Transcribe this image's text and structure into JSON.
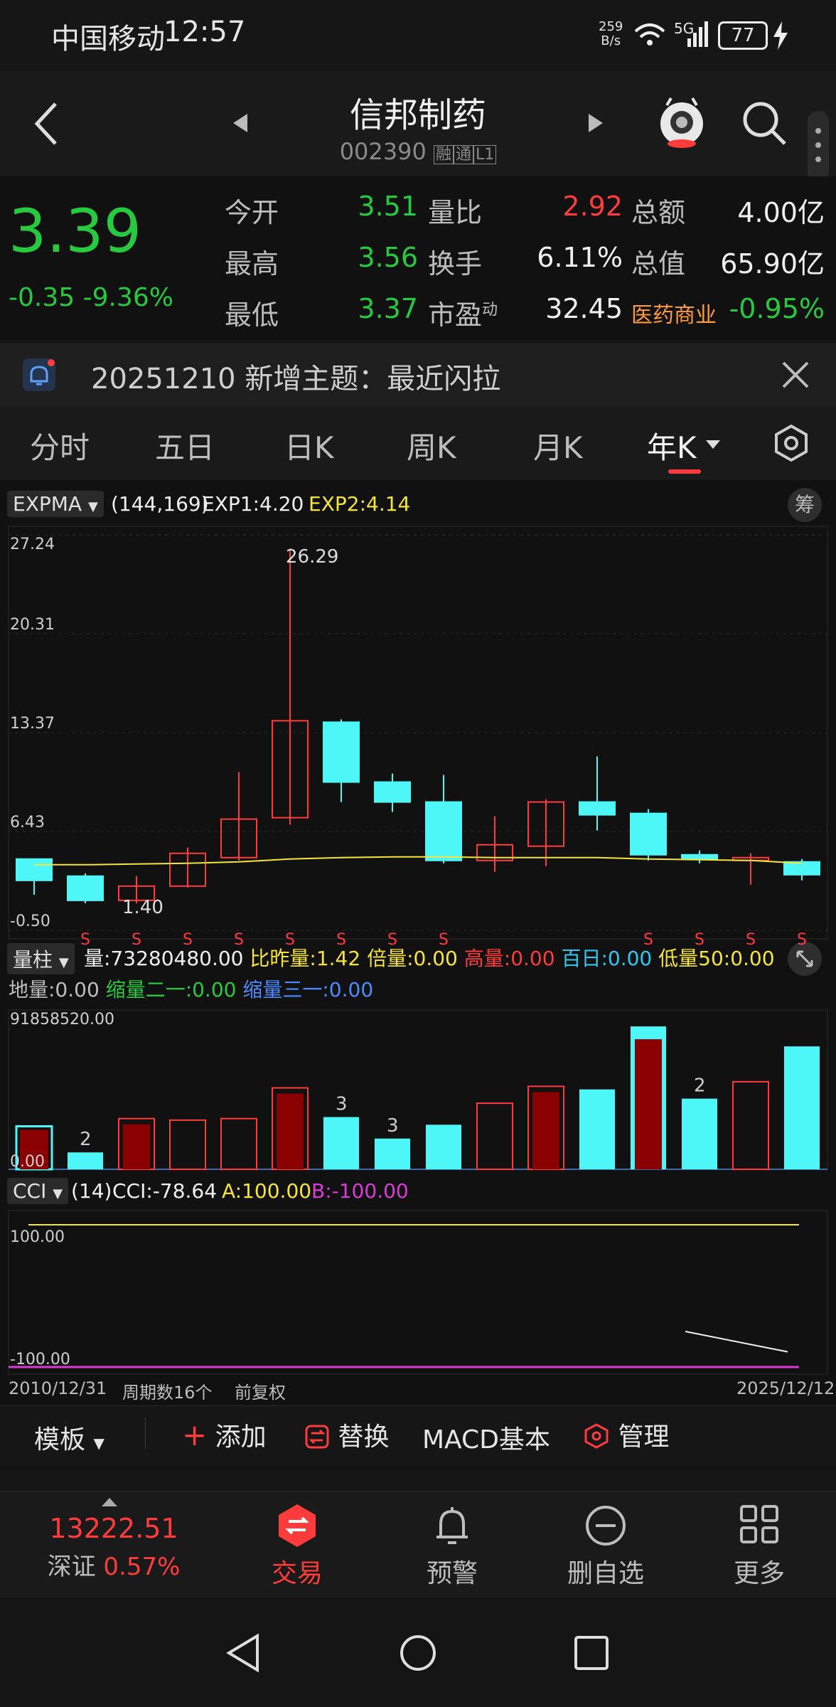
{
  "status_bar": {
    "carrier": "中国移动",
    "time": "12:57",
    "net_speed_value": "259",
    "net_speed_unit": "B/s",
    "network": "5G",
    "battery": "77"
  },
  "header": {
    "stock_name": "信邦制药",
    "stock_code": "002390",
    "tags": [
      "融",
      "通",
      "L1"
    ]
  },
  "quote": {
    "price": "3.39",
    "change": "-0.35",
    "change_pct": "-9.36%",
    "fields": [
      {
        "label": "今开",
        "value": "3.51"
      },
      {
        "label": "量比",
        "value": "2.92"
      },
      {
        "label": "总额",
        "value": "4.00亿"
      },
      {
        "label": "最高",
        "value": "3.56"
      },
      {
        "label": "换手",
        "value": "6.11%"
      },
      {
        "label": "总值",
        "value": "65.90亿"
      },
      {
        "label": "最低",
        "value": "3.37"
      },
      {
        "label": "市盈",
        "label_sup": "动",
        "value": "32.45"
      },
      {
        "label": "医药商业",
        "value": "-0.95%"
      }
    ]
  },
  "notice": {
    "text": "20251210 新增主题：最近闪拉"
  },
  "tabs": [
    "分时",
    "五日",
    "日K",
    "周K",
    "月K",
    "年K"
  ],
  "active_tab": "年K",
  "main_indicator": {
    "name": "EXPMA",
    "params": "(144,169)",
    "exp1": "EXP1:4.20",
    "exp2": "EXP2:4.14",
    "chip_label": "筹",
    "y_ticks": [
      "27.24",
      "20.31",
      "13.37",
      "6.43",
      "-0.50"
    ],
    "high_label": "26.29",
    "low_label": "1.40",
    "s_marker": "S"
  },
  "volume_indicator": {
    "name": "量柱",
    "labels": [
      {
        "text": "量:73280480.00",
        "color": "#f0f0f0"
      },
      {
        "text": "比昨量:1.42",
        "color": "#f5e43a"
      },
      {
        "text": "倍量:0.00",
        "color": "#f5e43a"
      },
      {
        "text": "高量:0.00",
        "color": "#ff3b3b"
      },
      {
        "text": "百日:0.00",
        "color": "#2fc9f0"
      },
      {
        "text": "低量50:0.00",
        "color": "#f5e43a"
      }
    ],
    "labels2": [
      {
        "text": "地量:0.00",
        "color": "#bdbdbd"
      },
      {
        "text": "缩量二一:0.00",
        "color": "#27c93f"
      },
      {
        "text": "缩量三一:0.00",
        "color": "#4b8bff"
      }
    ],
    "y_ticks": [
      "91858520.00",
      "0.00"
    ],
    "bar_marks": [
      "2",
      "3",
      "3",
      "2"
    ]
  },
  "cci_indicator": {
    "name": "CCI",
    "params": "(14)",
    "cci": "CCI:-78.64",
    "a": "A:100.00",
    "b": "B:-100.00",
    "y_ticks": [
      "100.00",
      "-100.00"
    ]
  },
  "axis_footer": {
    "start": "2010/12/31",
    "period": "周期数16个",
    "adjust": "前复权",
    "end": "2025/12/12"
  },
  "chart_data": {
    "type": "candlestick",
    "ylim": [
      -0.5,
      27.24
    ],
    "candles": [
      {
        "o": 4.5,
        "c": 3.0,
        "h": 4.5,
        "l": 2.0,
        "dir": "down",
        "s": false
      },
      {
        "o": 3.3,
        "c": 1.6,
        "h": 3.5,
        "l": 1.4,
        "dir": "down",
        "s": true
      },
      {
        "o": 1.6,
        "c": 2.6,
        "h": 3.3,
        "l": 1.4,
        "dir": "up",
        "s": true
      },
      {
        "o": 2.6,
        "c": 4.9,
        "h": 5.3,
        "l": 2.5,
        "dir": "up",
        "s": true
      },
      {
        "o": 4.6,
        "c": 7.3,
        "h": 10.6,
        "l": 4.4,
        "dir": "up",
        "s": true
      },
      {
        "o": 7.4,
        "c": 14.2,
        "h": 26.29,
        "l": 6.9,
        "dir": "up",
        "s": true
      },
      {
        "o": 14.1,
        "c": 9.9,
        "h": 14.3,
        "l": 8.5,
        "dir": "down",
        "s": true
      },
      {
        "o": 9.9,
        "c": 8.5,
        "h": 10.5,
        "l": 7.8,
        "dir": "down",
        "s": true
      },
      {
        "o": 8.5,
        "c": 4.4,
        "h": 10.4,
        "l": 4.2,
        "dir": "down",
        "s": true
      },
      {
        "o": 4.4,
        "c": 5.5,
        "h": 7.5,
        "l": 3.6,
        "dir": "up",
        "s": false
      },
      {
        "o": 5.4,
        "c": 8.5,
        "h": 8.7,
        "l": 4.0,
        "dir": "up",
        "s": false
      },
      {
        "o": 8.5,
        "c": 7.6,
        "h": 11.7,
        "l": 6.5,
        "dir": "down",
        "s": false
      },
      {
        "o": 7.7,
        "c": 4.8,
        "h": 8.0,
        "l": 4.4,
        "dir": "down",
        "s": true
      },
      {
        "o": 4.8,
        "c": 4.5,
        "h": 5.1,
        "l": 4.2,
        "dir": "down",
        "s": true
      },
      {
        "o": 4.4,
        "c": 4.6,
        "h": 4.9,
        "l": 2.7,
        "dir": "up",
        "s": true
      },
      {
        "o": 4.3,
        "c": 3.4,
        "h": 4.5,
        "l": 3.0,
        "dir": "down",
        "s": true
      }
    ],
    "expma": [
      4.1,
      4.1,
      4.15,
      4.2,
      4.3,
      4.5,
      4.6,
      4.65,
      4.65,
      4.6,
      4.6,
      4.6,
      4.5,
      4.45,
      4.4,
      4.2
    ],
    "volume": [
      {
        "v": 0.28,
        "type": "hollow-red-fill"
      },
      {
        "v": 0.11,
        "type": "cyan"
      },
      {
        "v": 0.33,
        "type": "red-fill"
      },
      {
        "v": 0.32,
        "type": "hollow-red"
      },
      {
        "v": 0.33,
        "type": "hollow-red"
      },
      {
        "v": 0.53,
        "type": "red-fill"
      },
      {
        "v": 0.34,
        "type": "cyan"
      },
      {
        "v": 0.2,
        "type": "cyan"
      },
      {
        "v": 0.29,
        "type": "cyan"
      },
      {
        "v": 0.43,
        "type": "hollow-red"
      },
      {
        "v": 0.54,
        "type": "red-fill"
      },
      {
        "v": 0.52,
        "type": "cyan"
      },
      {
        "v": 0.93,
        "type": "cyan-red-fill"
      },
      {
        "v": 0.46,
        "type": "cyan"
      },
      {
        "v": 0.57,
        "type": "hollow-red"
      },
      {
        "v": 0.8,
        "type": "cyan"
      }
    ],
    "cci": {
      "ylim": [
        -110,
        110
      ],
      "a": 100,
      "b": -100,
      "segment": [
        [
          13,
          -50
        ],
        [
          15,
          -78.64
        ]
      ]
    }
  },
  "toolbar": {
    "template": "模板",
    "add": "添加",
    "replace": "替换",
    "macd": "MACD基本",
    "manage": "管理"
  },
  "bottom_nav": {
    "index_value": "13222.51",
    "index_name": "深证",
    "index_change": "0.57%",
    "items": [
      "交易",
      "预警",
      "删自选",
      "更多"
    ]
  },
  "colors": {
    "up": "#ff3b3b",
    "down": "#27c93f",
    "cyan": "#4ef7f7",
    "yellow": "#f5e43a",
    "magenta": "#d63cd6"
  }
}
